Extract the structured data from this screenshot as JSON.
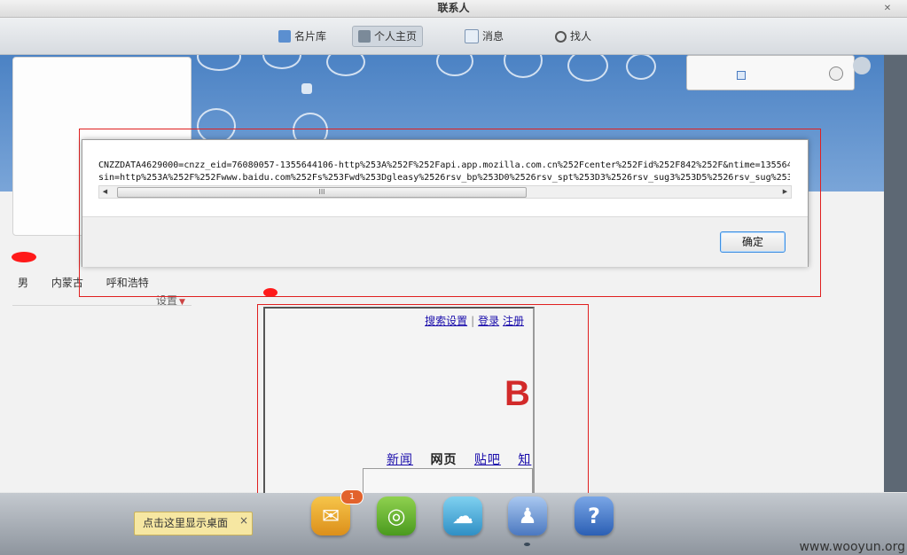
{
  "window": {
    "title": "联系人"
  },
  "nav": {
    "items": [
      {
        "label": "名片库"
      },
      {
        "label": "个人主页"
      },
      {
        "label": "消息"
      },
      {
        "label": "找人"
      }
    ],
    "active": "个人主页"
  },
  "profile": {
    "gender": "男",
    "province": "内蒙古",
    "city": "呼和浩特",
    "settings_label": "设置"
  },
  "dialog": {
    "line1": "CNZZDATA4629000=cnzz_eid=76080057-1355644106-http%253A%252F%252Fapi.app.mozilla.com.cn%252Fcenter%252Fid%252F842%252F&ntime=135564",
    "line2": "sin=http%253A%252F%252Fwww.baidu.com%252Fs%253Fwd%253Dgleasy%2526rsv_bp%253D0%2526rsv_spt%253D3%2526rsv_sug3%253D5%2526rsv_sug%253",
    "scroll_left": "◀",
    "scroll_right": "▶",
    "scroll_grip": "III",
    "ok_label": "确定"
  },
  "baidu_frame": {
    "link_settings": "搜索设置",
    "separator": "|",
    "link_login": "登录",
    "link_register": "注册",
    "logo_partial": "B",
    "tabs": [
      {
        "label": "新闻",
        "current": false
      },
      {
        "label": "网页",
        "current": true
      },
      {
        "label": "贴吧",
        "current": false
      },
      {
        "label": "知",
        "current": false
      }
    ]
  },
  "dock": {
    "badge_count": "1",
    "icons": [
      "mail-icon",
      "chat-icon",
      "cloud-icon",
      "contacts-icon",
      "help-icon"
    ],
    "help_glyph": "?",
    "tooltip": "点击这里显示桌面",
    "tooltip_close": "×"
  },
  "watermark": "www.wooyun.org",
  "colors": {
    "banner_blue": "#4b82c4",
    "annotation_red": "#e02020",
    "ok_border": "#3c8de0",
    "tooltip_bg": "#f6e7a2"
  }
}
